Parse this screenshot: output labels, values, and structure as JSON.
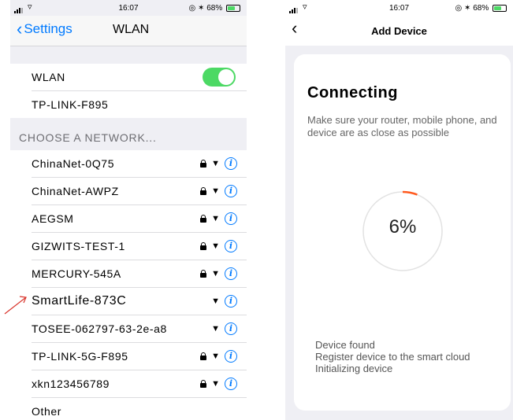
{
  "left_phone": {
    "status": {
      "time": "16:07",
      "battery": "68%"
    },
    "nav": {
      "back_label": "Settings",
      "title": "WLAN"
    },
    "wlan_toggle": {
      "label": "WLAN",
      "on": true
    },
    "connected_network": "TP-LINK-F895",
    "section_header": "CHOOSE A NETWORK...",
    "networks": [
      {
        "name": "ChinaNet-0Q75",
        "locked": true
      },
      {
        "name": "ChinaNet-AWPZ",
        "locked": true
      },
      {
        "name": "AEGSM",
        "locked": true
      },
      {
        "name": "GIZWITS-TEST-1",
        "locked": true
      },
      {
        "name": "MERCURY-545A",
        "locked": true
      },
      {
        "name": "SmartLife-873C",
        "locked": false
      },
      {
        "name": "TOSEE-062797-63-2e-a8",
        "locked": false
      },
      {
        "name": "TP-LINK-5G-F895",
        "locked": true
      },
      {
        "name": "xkn123456789",
        "locked": true
      }
    ],
    "other_label": "Other"
  },
  "right_phone": {
    "status": {
      "time": "16:07",
      "battery": "68%"
    },
    "nav": {
      "title": "Add Device"
    },
    "title": "Connecting",
    "subtitle": "Make sure your router, mobile phone, and device are as close as possible",
    "progress": {
      "value": 6,
      "label": "6%"
    },
    "status_lines": [
      "Device found",
      "Register device to the smart cloud",
      "Initializing device"
    ]
  },
  "colors": {
    "accent": "#007aff",
    "toggle_on": "#4cd964",
    "progress": "#ff5a1f",
    "arrow": "#d9342b"
  },
  "icons": {
    "lock": "lock-icon",
    "wifi": "wifi-icon",
    "info": "info-icon",
    "back": "chevron-left-icon"
  }
}
